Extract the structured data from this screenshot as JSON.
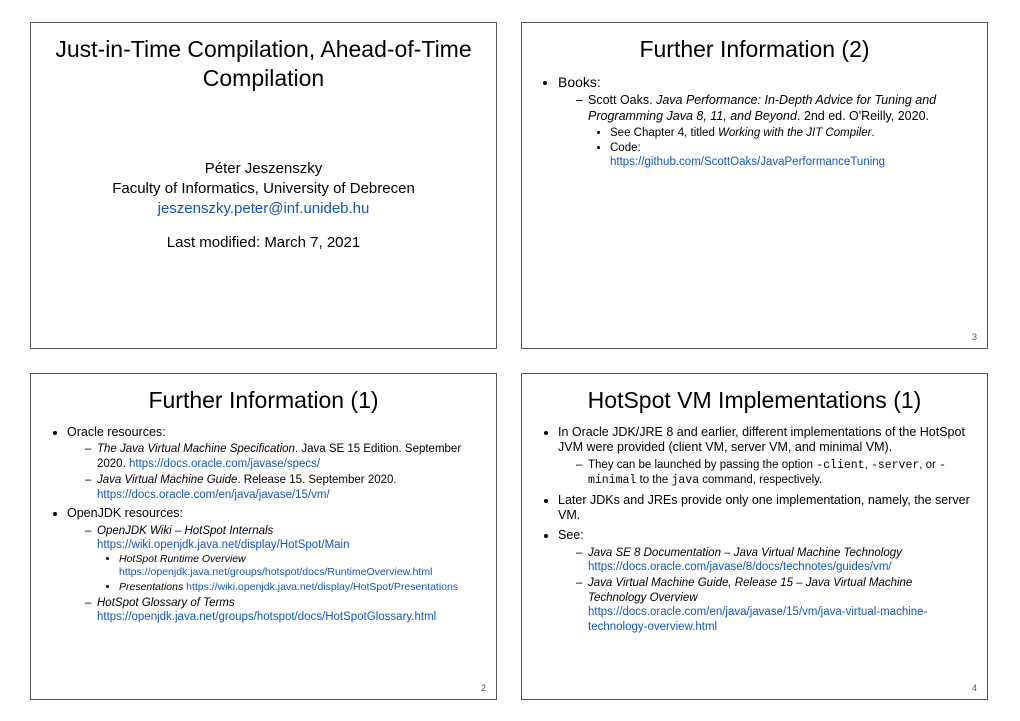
{
  "slide1": {
    "title": "Just-in-Time Compilation, Ahead-of-Time Compilation",
    "author": "Péter Jeszenszky",
    "affiliation": "Faculty of Informatics, University of Debrecen",
    "email": "jeszenszky.peter@inf.unideb.hu",
    "modified": "Last modified: March 7, 2021"
  },
  "slide2": {
    "title": "Further Information (1)",
    "page": "2",
    "b1_label": "Oracle resources:",
    "b1a_pre": "The Java Virtual Machine Specification",
    "b1a_post": ". Java SE 15 Edition. September 2020. ",
    "b1a_link": "https://docs.oracle.com/javase/specs/",
    "b1b_pre": "Java Virtual Machine Guide",
    "b1b_post": ". Release 15. September 2020. ",
    "b1b_link": "https://docs.oracle.com/en/java/javase/15/vm/",
    "b2_label": "OpenJDK resources:",
    "b2a_pre": "OpenJDK Wiki – HotSpot Internals",
    "b2a_link": "https://wiki.openjdk.java.net/display/HotSpot/Main",
    "b2a_i_pre": "HotSpot Runtime Overview",
    "b2a_i_link": "https://openjdk.java.net/groups/hotspot/docs/RuntimeOverview.html",
    "b2a_ii_pre": "Presentations ",
    "b2a_ii_link": "https://wiki.openjdk.java.net/display/HotSpot/Presentations",
    "b2b_pre": "HotSpot Glossary of Terms",
    "b2b_link": "https://openjdk.java.net/groups/hotspot/docs/HotSpotGlossary.html"
  },
  "slide3": {
    "title": "Further Information (2)",
    "page": "3",
    "books_label": "Books:",
    "oaks_pre": "Scott Oaks. ",
    "oaks_title": "Java Performance: In-Depth Advice for Tuning and Programming Java 8, 11, and Beyond",
    "oaks_post": ". 2nd ed. O'Reilly, 2020.",
    "ch_pre": "See Chapter 4, titled ",
    "ch_title": "Working with the JIT Compiler",
    "ch_post": ".",
    "code_label": "Code:",
    "code_link": "https://github.com/ScottOaks/JavaPerformanceTuning"
  },
  "slide4": {
    "title": "HotSpot VM Implementations (1)",
    "page": "4",
    "p1": "In Oracle JDK/JRE 8 and earlier, different implementations of the HotSpot JVM were provided (client VM, server VM, and minimal VM).",
    "p1a_pre": "They can be launched by passing the option ",
    "p1a_c1": "-client",
    "p1a_mid1": ", ",
    "p1a_c2": "-server",
    "p1a_mid2": ", or ",
    "p1a_c3": "-minimal",
    "p1a_mid3": " to the ",
    "p1a_c4": "java",
    "p1a_post": " command, respectively.",
    "p2": "Later JDKs and JREs provide only one implementation, namely, the server VM.",
    "see_label": "See:",
    "see_a_title": "Java SE 8 Documentation – Java Virtual Machine Technology",
    "see_a_link": "https://docs.oracle.com/javase/8/docs/technotes/guides/vm/",
    "see_b_title": "Java Virtual Machine Guide, Release 15 – Java Virtual Machine Technology Overview",
    "see_b_link": "https://docs.oracle.com/en/java/javase/15/vm/java-virtual-machine-technology-overview.html"
  }
}
